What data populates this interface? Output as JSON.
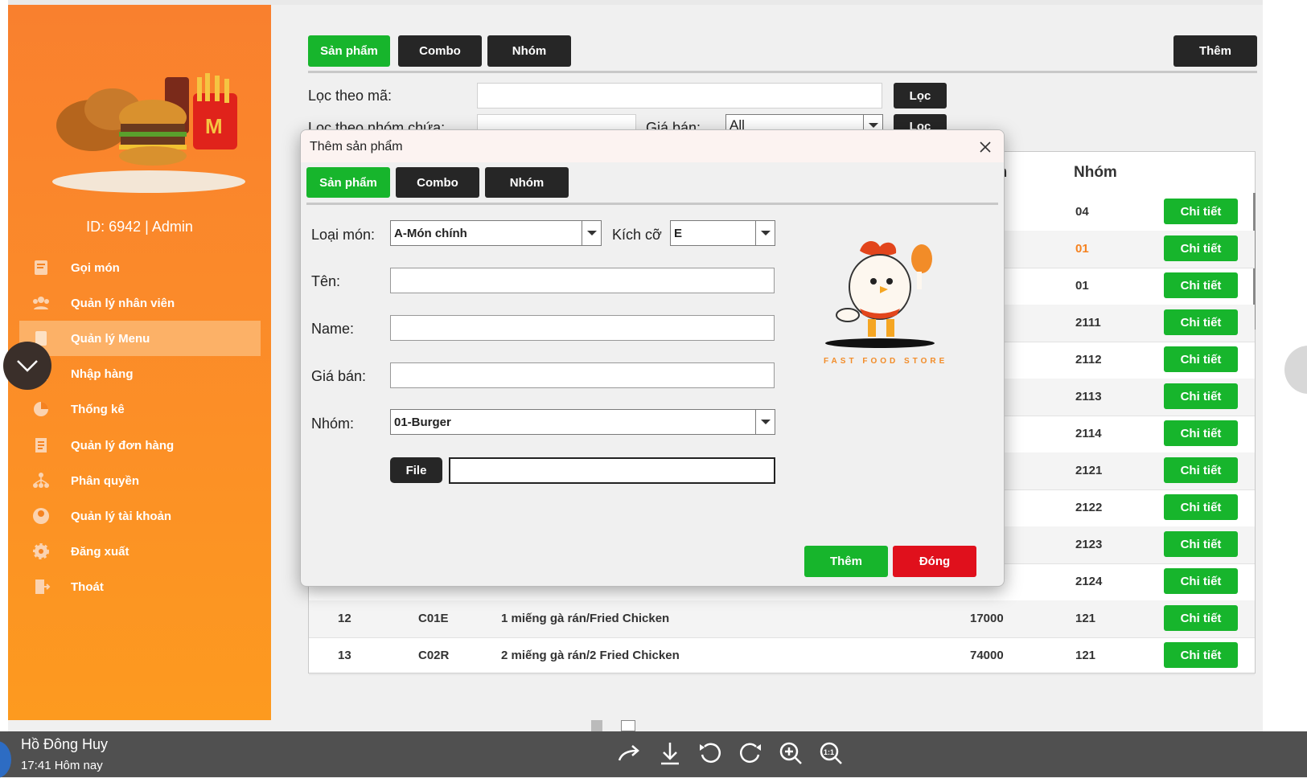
{
  "main": {
    "tabs": [
      {
        "label": "Sản phẩm",
        "active": true
      },
      {
        "label": "Combo",
        "active": false
      },
      {
        "label": "Nhóm",
        "active": false
      }
    ],
    "add_label": "Thêm",
    "filter_code_label": "Lọc theo mã:",
    "filter_group_label": "Lọc theo nhóm chứa:",
    "price_label": "Giá bán:",
    "price_select_value": "All",
    "filter_button": "Lọc",
    "filter_button_2": "Lọc",
    "table": {
      "partial_header_price": "ền",
      "header_group": "Nhóm",
      "detail_label": "Chi tiết",
      "rows": [
        {
          "stt": "",
          "ma": "",
          "ten": "",
          "gia": "",
          "nhom": "04"
        },
        {
          "stt": "",
          "ma": "",
          "ten": "",
          "gia": "",
          "nhom": "01"
        },
        {
          "stt": "",
          "ma": "",
          "ten": "",
          "gia": "",
          "nhom": "01"
        },
        {
          "stt": "",
          "ma": "",
          "ten": "",
          "gia": "",
          "nhom": "2111"
        },
        {
          "stt": "",
          "ma": "",
          "ten": "",
          "gia": "",
          "nhom": "2112"
        },
        {
          "stt": "",
          "ma": "",
          "ten": "",
          "gia": "",
          "nhom": "2113"
        },
        {
          "stt": "",
          "ma": "",
          "ten": "",
          "gia": "",
          "nhom": "2114"
        },
        {
          "stt": "",
          "ma": "",
          "ten": "",
          "gia": "",
          "nhom": "2121"
        },
        {
          "stt": "",
          "ma": "",
          "ten": "",
          "gia": "",
          "nhom": "2122"
        },
        {
          "stt": "",
          "ma": "",
          "ten": "",
          "gia": "",
          "nhom": "2123"
        },
        {
          "stt": "",
          "ma": "",
          "ten": "",
          "gia": "",
          "nhom": "2124"
        },
        {
          "stt": "12",
          "ma": "C01E",
          "ten": "1 miếng gà rán/Fried Chicken",
          "gia": "17000",
          "nhom": "121"
        },
        {
          "stt": "13",
          "ma": "C02R",
          "ten": "2 miếng gà rán/2 Fried Chicken",
          "gia": "74000",
          "nhom": "121"
        }
      ]
    }
  },
  "sidebar": {
    "admin_id": "ID: 6942 | Admin",
    "items": [
      {
        "label": "Gọi món",
        "icon": "order-icon"
      },
      {
        "label": "Quản lý nhân viên",
        "icon": "staff-icon"
      },
      {
        "label": "Quản lý Menu",
        "icon": "menu-icon",
        "active": true
      },
      {
        "label": "Nhập hàng",
        "icon": "import-icon"
      },
      {
        "label": "Thống kê",
        "icon": "stats-icon"
      },
      {
        "label": "Quản lý đơn hàng",
        "icon": "orders-icon"
      },
      {
        "label": "Phân quyền",
        "icon": "permission-icon"
      },
      {
        "label": "Quản lý tài khoản",
        "icon": "account-icon"
      },
      {
        "label": "Đăng xuất",
        "icon": "gear-icon"
      },
      {
        "label": "Thoát",
        "icon": "exit-icon"
      }
    ]
  },
  "dialog": {
    "title": "Thêm sản phẩm",
    "tabs": [
      {
        "label": "Sản phẩm",
        "active": true
      },
      {
        "label": "Combo",
        "active": false
      },
      {
        "label": "Nhóm",
        "active": false
      }
    ],
    "type_label": "Loại món:",
    "type_value": "A-Món chính",
    "size_label": "Kích cỡ",
    "size_value": "E",
    "name_vi_label": "Tên:",
    "name_en_label": "Name:",
    "price_label": "Giá bán:",
    "group_label": "Nhóm:",
    "group_value": "01-Burger",
    "file_button": "File",
    "logo_text": "FAST FOOD STORE",
    "add_button": "Thêm",
    "close_button": "Đóng"
  },
  "taskbar": {
    "user": "Hồ Đông Huy",
    "time": "17:41 Hôm nay"
  },
  "colors": {
    "sidebar_orange": "#fb8a2a",
    "green": "#17b52c",
    "red": "#e0101c",
    "dark_button": "#262626"
  }
}
